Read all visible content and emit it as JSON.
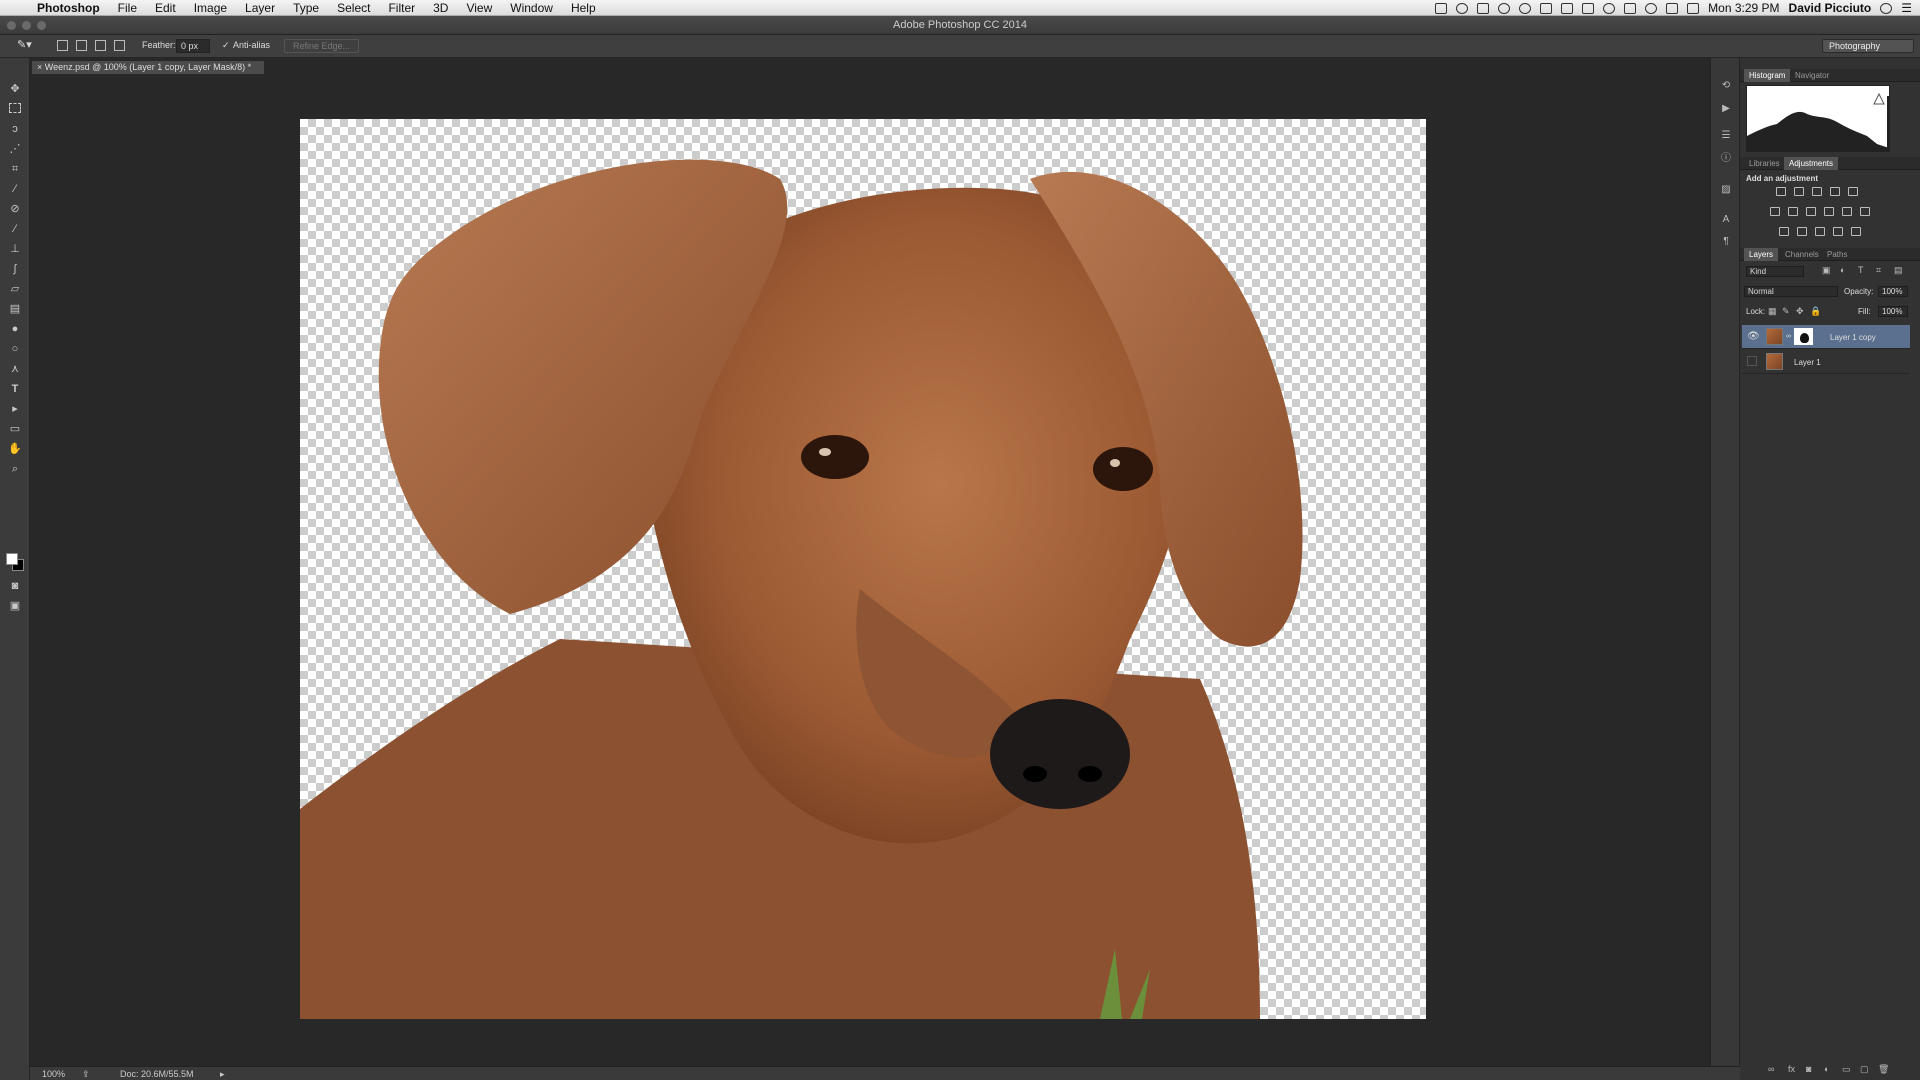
{
  "menubar": {
    "apple": "",
    "app_name": "Photoshop",
    "items": [
      "File",
      "Edit",
      "Image",
      "Layer",
      "Type",
      "Select",
      "Filter",
      "3D",
      "View",
      "Window",
      "Help"
    ],
    "clock": "Mon 3:29 PM",
    "user": "David Picciuto"
  },
  "window_title": "Adobe Photoshop CC 2014",
  "options_bar": {
    "feather_label": "Feather:",
    "feather_value": "0 px",
    "anti_alias_label": "Anti-alias",
    "anti_alias_checked": true,
    "refine_edge_label": "Refine Edge...",
    "workspace": "Photography"
  },
  "document": {
    "tab_close": "×",
    "tab_title": "Weenz.psd @ 100% (Layer 1 copy, Layer Mask/8) *"
  },
  "status": {
    "zoom": "100%",
    "doc_size": "Doc: 20.6M/55.5M"
  },
  "panels": {
    "histogram_tabs": [
      "Histogram",
      "Navigator"
    ],
    "adjust_tabs": [
      "Libraries",
      "Adjustments"
    ],
    "add_adjustment": "Add an adjustment",
    "layers_tabs": [
      "Layers",
      "Channels",
      "Paths"
    ],
    "kind": "Kind",
    "blend_mode": "Normal",
    "opacity_label": "Opacity:",
    "opacity": "100%",
    "lock_label": "Lock:",
    "fill_label": "Fill:",
    "fill": "100%",
    "layers": [
      {
        "name": "Layer 1 copy",
        "visible": true,
        "selected": true,
        "has_mask": true
      },
      {
        "name": "Layer 1",
        "visible": false,
        "selected": false,
        "has_mask": false
      }
    ]
  },
  "colors": {
    "selected_layer": "#5b6f8f",
    "panel_bg": "#323232",
    "workspace_bg": "#282828"
  }
}
